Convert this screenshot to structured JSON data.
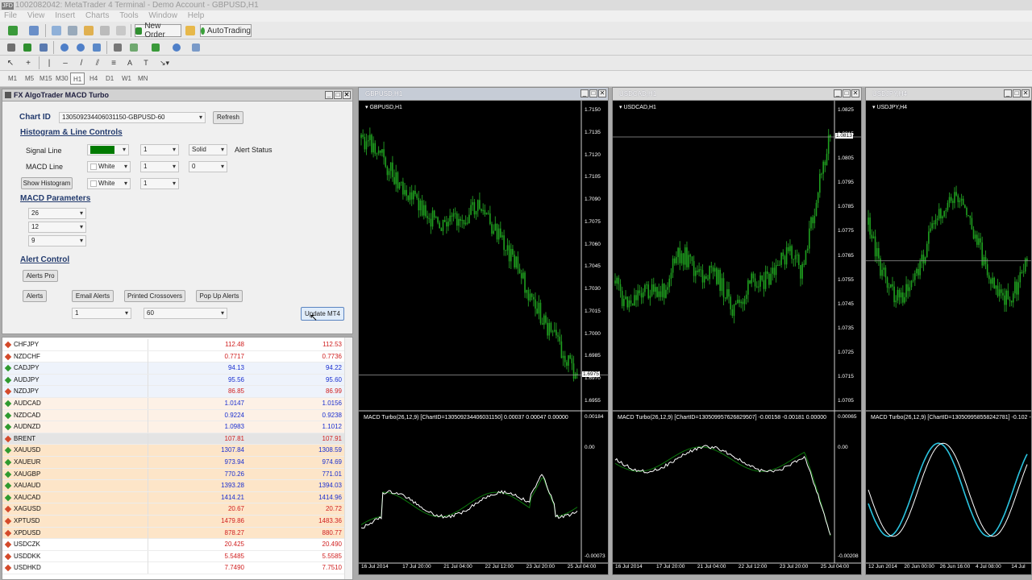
{
  "window": {
    "title": "1002082042: MetaTrader 4 Terminal - Demo Account - GBPUSD,H1",
    "logo": "JFD"
  },
  "menu": [
    "File",
    "View",
    "Insert",
    "Charts",
    "Tools",
    "Window",
    "Help"
  ],
  "toolbar": {
    "new_order": "New Order",
    "autotrading": "AutoTrading"
  },
  "timeframes": [
    "M1",
    "M5",
    "M15",
    "M30",
    "H1",
    "H4",
    "D1",
    "W1",
    "MN"
  ],
  "active_timeframe": "H1",
  "panel": {
    "title": "FX AlgoTrader MACD Turbo",
    "chart_id_label": "Chart ID",
    "chart_id_value": "130509234406031150-GBPUSD-60",
    "refresh": "Refresh",
    "hist_section": "Histogram & Line Controls",
    "signal_line": "Signal Line",
    "signal_width": "1",
    "signal_style": "Solid",
    "alert_status": "Alert Status",
    "macd_line": "MACD Line",
    "macd_color": "White",
    "macd_width": "1",
    "macd_extra": "0",
    "show_histogram": "Show Histogram",
    "hist_color": "White",
    "hist_width": "1",
    "params_section": "MACD Parameters",
    "param_fast": "26",
    "param_slow": "12",
    "param_signal": "9",
    "alert_section": "Alert Control",
    "alerts_pro": "Alerts Pro",
    "alerts": "Alerts",
    "email_alerts": "Email Alerts",
    "printed_crossovers": "Printed Crossovers",
    "popup_alerts": "Pop Up Alerts",
    "alert_count": "1",
    "alert_minutes": "60",
    "update": "Update MT4",
    "signal_color_hex": "#007a00"
  },
  "watchlist": [
    {
      "sym": "CHFJPY",
      "bid": "112.48",
      "ask": "112.53",
      "up": false,
      "bg": "#ffffff",
      "color": "#d02020"
    },
    {
      "sym": "NZDCHF",
      "bid": "0.7717",
      "ask": "0.7736",
      "up": false,
      "bg": "#ffffff",
      "color": "#d02020"
    },
    {
      "sym": "CADJPY",
      "bid": "94.13",
      "ask": "94.22",
      "up": true,
      "bg": "#eef3fb",
      "color": "#1a2fd0"
    },
    {
      "sym": "AUDJPY",
      "bid": "95.56",
      "ask": "95.60",
      "up": true,
      "bg": "#eef3fb",
      "color": "#1a2fd0"
    },
    {
      "sym": "NZDJPY",
      "bid": "86.85",
      "ask": "86.99",
      "up": false,
      "bg": "#eef3fb",
      "color": "#d02020"
    },
    {
      "sym": "AUDCAD",
      "bid": "1.0147",
      "ask": "1.0156",
      "up": true,
      "bg": "#fdf1e6",
      "color": "#1a2fd0"
    },
    {
      "sym": "NZDCAD",
      "bid": "0.9224",
      "ask": "0.9238",
      "up": true,
      "bg": "#fdf1e6",
      "color": "#1a2fd0"
    },
    {
      "sym": "AUDNZD",
      "bid": "1.0983",
      "ask": "1.1012",
      "up": true,
      "bg": "#fdf1e6",
      "color": "#1a2fd0"
    },
    {
      "sym": "BRENT",
      "bid": "107.81",
      "ask": "107.91",
      "up": false,
      "bg": "#e4e4e4",
      "color": "#d02020"
    },
    {
      "sym": "XAUUSD",
      "bid": "1307.84",
      "ask": "1308.59",
      "up": true,
      "bg": "#fde5c8",
      "color": "#1a2fd0"
    },
    {
      "sym": "XAUEUR",
      "bid": "973.94",
      "ask": "974.69",
      "up": true,
      "bg": "#fde5c8",
      "color": "#1a2fd0"
    },
    {
      "sym": "XAUGBP",
      "bid": "770.26",
      "ask": "771.01",
      "up": true,
      "bg": "#fde5c8",
      "color": "#1a2fd0"
    },
    {
      "sym": "XAUAUD",
      "bid": "1393.28",
      "ask": "1394.03",
      "up": true,
      "bg": "#fde5c8",
      "color": "#1a2fd0"
    },
    {
      "sym": "XAUCAD",
      "bid": "1414.21",
      "ask": "1414.96",
      "up": true,
      "bg": "#fde5c8",
      "color": "#1a2fd0"
    },
    {
      "sym": "XAGUSD",
      "bid": "20.67",
      "ask": "20.72",
      "up": false,
      "bg": "#fde5c8",
      "color": "#d02020"
    },
    {
      "sym": "XPTUSD",
      "bid": "1479.86",
      "ask": "1483.36",
      "up": false,
      "bg": "#fde5c8",
      "color": "#d02020"
    },
    {
      "sym": "XPDUSD",
      "bid": "878.27",
      "ask": "880.77",
      "up": false,
      "bg": "#fde5c8",
      "color": "#d02020"
    },
    {
      "sym": "USDCZK",
      "bid": "20.425",
      "ask": "20.490",
      "up": false,
      "bg": "#ffffff",
      "color": "#d02020"
    },
    {
      "sym": "USDDKK",
      "bid": "5.5485",
      "ask": "5.5585",
      "up": false,
      "bg": "#ffffff",
      "color": "#d02020"
    },
    {
      "sym": "USDHKD",
      "bid": "7.7490",
      "ask": "7.7510",
      "up": false,
      "bg": "#ffffff",
      "color": "#d02020"
    }
  ],
  "charts": [
    {
      "title": "GBPUSD,H1",
      "inner": "GBPUSD,H1",
      "prices": [
        "1.7150",
        "1.7135",
        "1.7120",
        "1.7105",
        "1.7090",
        "1.7075",
        "1.7060",
        "1.7045",
        "1.7030",
        "1.7015",
        "1.7000",
        "1.6985",
        "1.6970",
        "1.6955"
      ],
      "current": "1.6975",
      "indicator": "MACD Turbo(26,12,9) [ChartID=130509234406031150] 0.00037 0.00047 0.00000",
      "ind_scale": [
        "0.00184",
        "0.00",
        "-0.00073"
      ],
      "dates": [
        "16 Jul 2014",
        "17 Jul 20:00",
        "21 Jul 04:00",
        "22 Jul 12:00",
        "23 Jul 20:00",
        "25 Jul 04:00"
      ]
    },
    {
      "title": "USDCAD,H1",
      "inner": "USDCAD,H1",
      "prices": [
        "1.0825",
        "1.0815",
        "1.0805",
        "1.0795",
        "1.0785",
        "1.0775",
        "1.0765",
        "1.0755",
        "1.0745",
        "1.0735",
        "1.0725",
        "1.0715",
        "1.0705"
      ],
      "current": "1.0813",
      "indicator": "MACD Turbo(26,12,9) [ChartID=130509957626829507] -0.00158 -0.00181 0.00000",
      "ind_scale": [
        "0.00065",
        "0.00",
        "-0.00208"
      ],
      "dates": [
        "16 Jul 2014",
        "17 Jul 20:00",
        "21 Jul 04:00",
        "22 Jul 12:00",
        "23 Jul 20:00",
        "25 Jul 04:00"
      ]
    },
    {
      "title": "USDJPY,H4",
      "inner": "USDJPY,H4",
      "indicator": "MACD Turbo(26,12,9) [ChartID=130509958558242781] -0.102 -0.",
      "dates": [
        "12 Jun 2014",
        "20 Jun 00:00",
        "26 Jun 16:00",
        "4 Jul 08:00",
        "14 Jul"
      ]
    }
  ]
}
